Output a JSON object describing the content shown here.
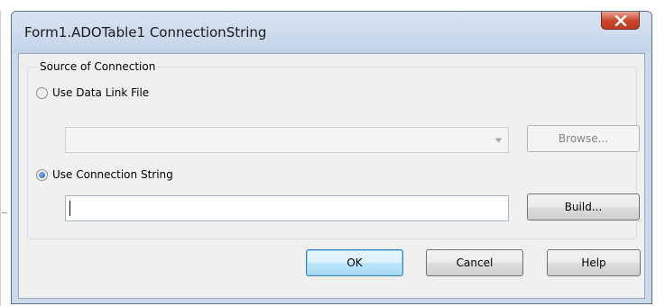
{
  "window": {
    "title": "Form1.ADOTable1 ConnectionString"
  },
  "group": {
    "caption": "Source of Connection"
  },
  "options": {
    "data_link_file": {
      "label": "Use Data Link File",
      "selected": false
    },
    "connection_string": {
      "label": "Use Connection String",
      "selected": true
    }
  },
  "data_link_combo": {
    "value": "",
    "enabled": false
  },
  "connection_string_input": {
    "value": ""
  },
  "buttons": {
    "browse": "Browse...",
    "build": "Build...",
    "ok": "OK",
    "cancel": "Cancel",
    "help": "Help"
  },
  "icons": {
    "close": "close-icon",
    "dropdown": "chevron-down-icon",
    "radio": "radio-icon"
  },
  "colors": {
    "close_button": "#c8442c",
    "title_bar": "#cbd9ea",
    "client_bg": "#f0f0f0",
    "focus_blue": "#3c7fb1"
  }
}
